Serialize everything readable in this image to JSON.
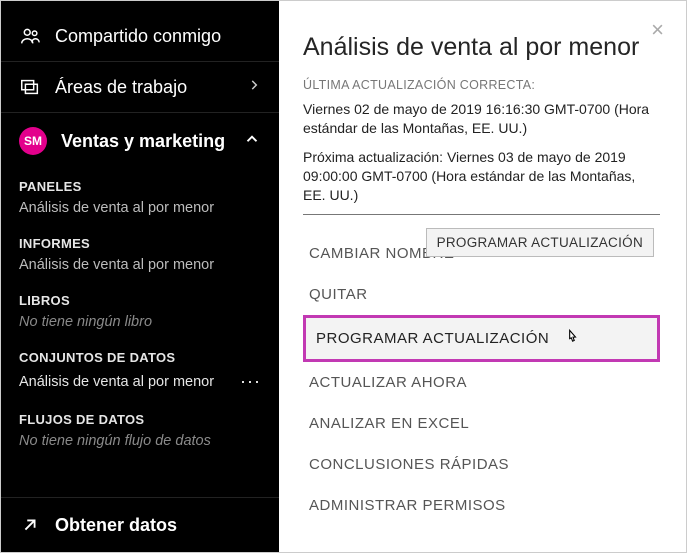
{
  "sidebar": {
    "shared": "Compartido conmigo",
    "workspaces_label": "Áreas de trabajo",
    "active_workspace": {
      "badge": "SM",
      "name": "Ventas y marketing"
    },
    "sections": {
      "panels": {
        "header": "PANELES",
        "item": "Análisis de venta al por menor"
      },
      "reports": {
        "header": "INFORMES",
        "item": "Análisis de venta al por menor"
      },
      "workbooks": {
        "header": "LIBROS",
        "empty": "No tiene ningún libro"
      },
      "datasets": {
        "header": "CONJUNTOS DE DATOS",
        "item": "Análisis de venta al por menor"
      },
      "dataflows": {
        "header": "FLUJOS DE DATOS",
        "empty": "No tiene ningún flujo de datos"
      }
    },
    "get_data": "Obtener datos"
  },
  "panel": {
    "title": "Análisis de venta al por menor",
    "last_refresh_label": "ÚLTIMA ACTUALIZACIÓN CORRECTA:",
    "last_refresh_value": "Viernes 02 de mayo de 2019 16:16:30 GMT-0700 (Hora estándar de las Montañas, EE. UU.)",
    "next_refresh_value": "Próxima actualización: Viernes 03 de mayo de 2019 09:00:00 GMT-0700 (Hora estándar de las Montañas, EE. UU.)",
    "tooltip": "PROGRAMAR ACTUALIZACIÓN",
    "menu": {
      "rename": "CAMBIAR NOMBRE",
      "remove": "QUITAR",
      "schedule_refresh": "PROGRAMAR ACTUALIZACIÓN",
      "refresh_now": "ACTUALIZAR AHORA",
      "analyze_excel": "ANALIZAR EN EXCEL",
      "quick_insights": "CONCLUSIONES RÁPIDAS",
      "manage_permissions": "ADMINISTRAR PERMISOS"
    }
  }
}
